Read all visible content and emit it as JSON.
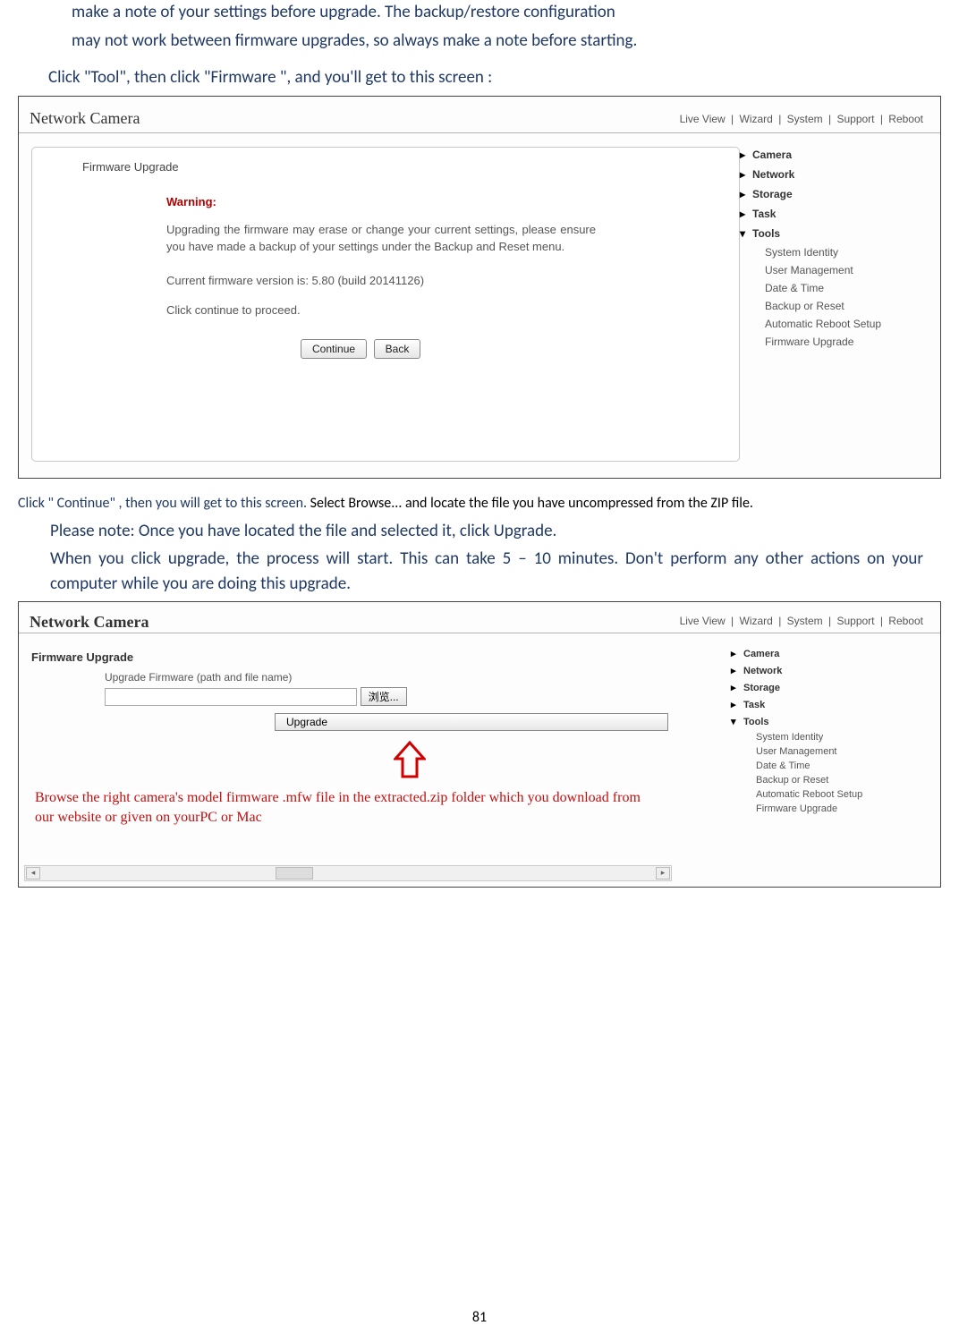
{
  "intro": {
    "line1": "make a note of your settings before upgrade. The backup/restore configuration",
    "line2": "may not work between firmware upgrades, so always make a note before starting."
  },
  "bullet_line": "Click \"Tool\", then click \"Firmware \", and you'll get to this screen :",
  "shot_common": {
    "title": "Network Camera",
    "nav": [
      "Live View",
      "Wizard",
      "System",
      "Support",
      "Reboot"
    ],
    "sidebar": {
      "items": [
        "Camera",
        "Network",
        "Storage",
        "Task",
        "Tools"
      ],
      "tools_sub": [
        "System Identity",
        "User Management",
        "Date & Time",
        "Backup or Reset",
        "Automatic Reboot Setup",
        "Firmware Upgrade"
      ]
    }
  },
  "shot1": {
    "heading": "Firmware Upgrade",
    "warning": "Warning:",
    "body1": "Upgrading the firmware may erase or change your current settings, please ensure you have made a backup of your settings under the Backup and Reset menu.",
    "body2": "Current firmware version is: 5.80 (build 20141126)",
    "body3": "Click continue to proceed.",
    "continue": "Continue",
    "back": "Back"
  },
  "caption2_red": "Click \" Continue\" , then you will get to this screen.",
  "caption2_black": " Select Browse... and locate the file you have uncompressed from the ZIP file.",
  "note1": "Please note: Once you have located the file and selected it, click Upgrade.",
  "note2": "When you click upgrade, the process will start. This can take 5 – 10 minutes. Don't perform any other actions on your computer while you are doing this upgrade.",
  "shot2": {
    "heading": "Firmware Upgrade",
    "path_label": "Upgrade Firmware (path and file name)",
    "browse": "浏览...",
    "upgrade": "Upgrade",
    "red_note": "Browse the right camera's model firmware .mfw file in the extracted.zip folder which you download from our website or given on yourPC or Mac"
  },
  "page_number": "81"
}
